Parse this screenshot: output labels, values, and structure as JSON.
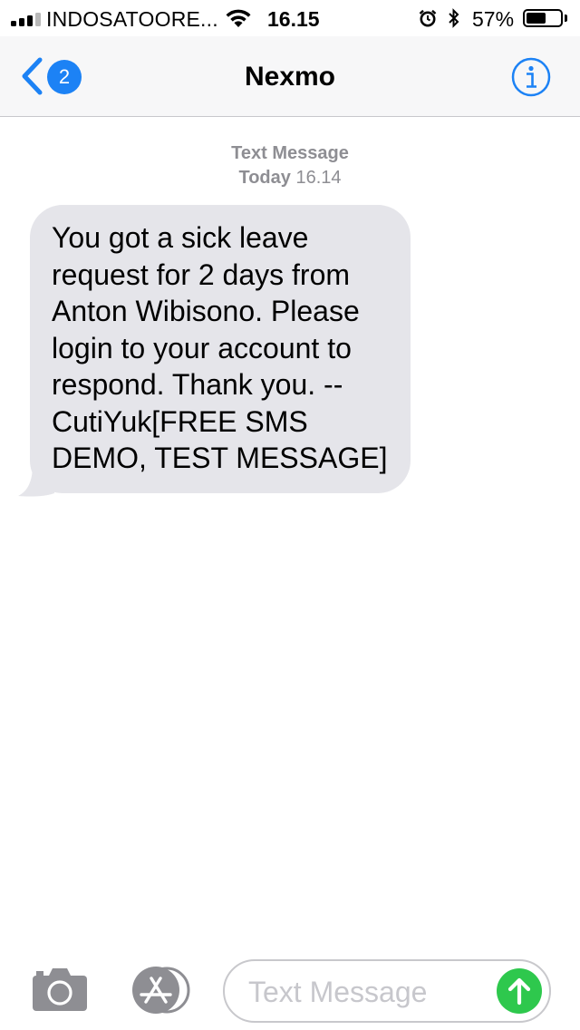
{
  "status_bar": {
    "carrier": "INDOSATOORE...",
    "time": "16.15",
    "battery_percent": "57%",
    "battery_level": 0.57,
    "signal_bars_filled": 3,
    "signal_bars_total": 4,
    "icons": [
      "signal-icon",
      "wifi-icon",
      "alarm-icon",
      "bluetooth-icon",
      "battery-icon"
    ]
  },
  "nav": {
    "back_badge": "2",
    "title": "Nexmo",
    "icons": [
      "back-chevron-icon",
      "info-icon"
    ]
  },
  "conversation": {
    "meta_kind": "Text Message",
    "meta_day": "Today",
    "meta_time": "16.14",
    "message": "You got a sick leave\nrequest for 2 days from\nAnton Wibisono. Please\nlogin to your account to\nrespond. Thank you. --\nCutiYuk[FREE SMS\nDEMO, TEST MESSAGE]"
  },
  "composer": {
    "placeholder": "Text Message",
    "icons": [
      "camera-icon",
      "appstore-icon",
      "send-arrow-icon"
    ]
  },
  "colors": {
    "accent": "#1c82f5",
    "bubble": "#e5e5ea",
    "send": "#2ec84d",
    "meta": "#8e8e93"
  }
}
